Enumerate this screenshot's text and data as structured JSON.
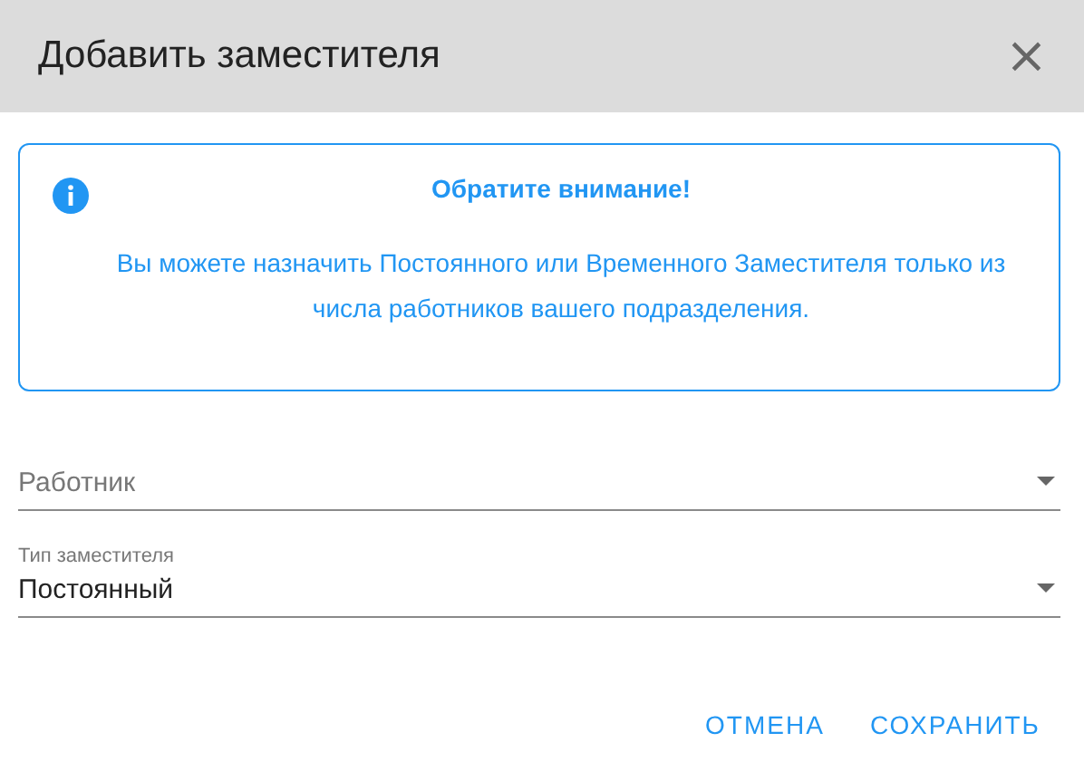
{
  "dialog": {
    "title": "Добавить заместителя",
    "close": "×"
  },
  "notice": {
    "heading": "Обратите внимание!",
    "text": "Вы можете назначить Постоянного или Временного Заместителя только из числа работников вашего подразделения."
  },
  "fields": [
    {
      "placeholder": "Работник"
    },
    {
      "label": "Тип заместителя",
      "value": "Постоянный"
    }
  ],
  "buttons": [
    "ОТМЕНА",
    "СОХРАНИТЬ"
  ]
}
